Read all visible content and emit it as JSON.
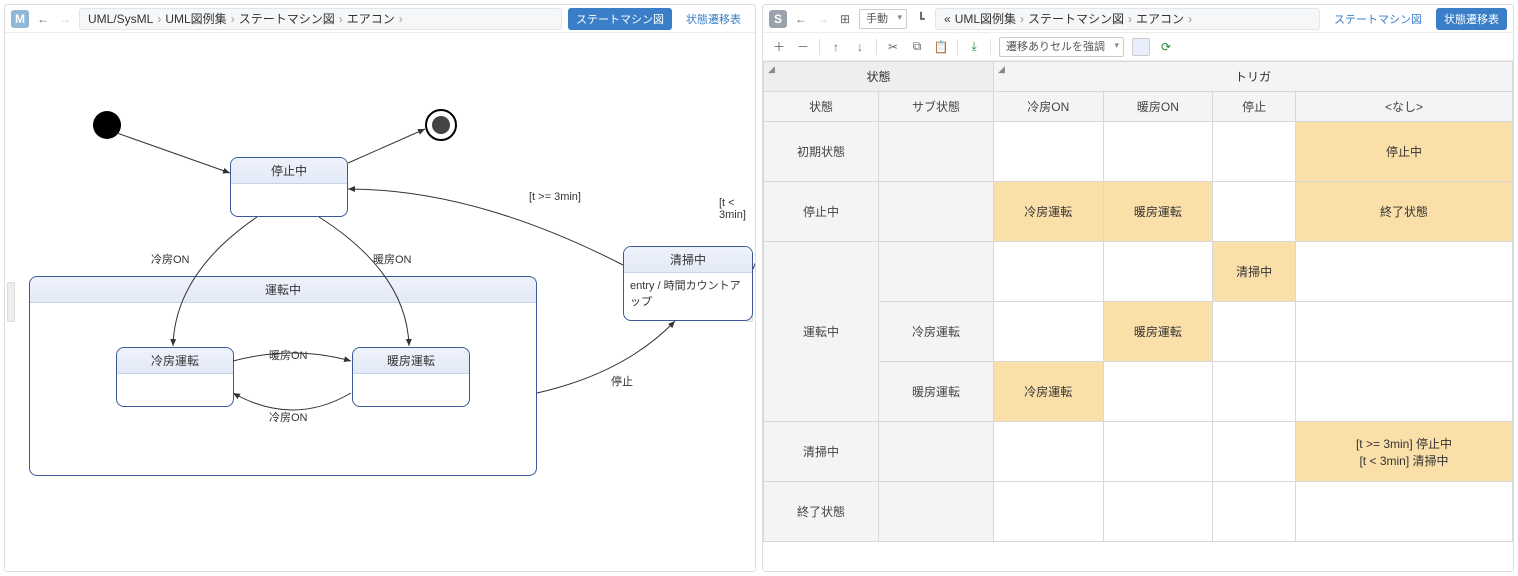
{
  "left": {
    "badge": "M",
    "crumbs": [
      "UML/SysML",
      "UML図例集",
      "ステートマシン図",
      "エアコン"
    ],
    "tab_active": "ステートマシン図",
    "tab_inactive": "状態遷移表"
  },
  "right": {
    "badge": "S",
    "crumbs_prefix": "«",
    "crumbs": [
      "UML図例集",
      "ステートマシン図",
      "エアコン"
    ],
    "tab_inactive": "ステートマシン図",
    "tab_active": "状態遷移表",
    "layout_label": "手動",
    "dropdown": "遷移ありセルを強調"
  },
  "states": {
    "stopped": "停止中",
    "running": "運転中",
    "cool": "冷房運転",
    "heat": "暖房運転",
    "clean": "清掃中",
    "clean_entry": "entry / 時間カウントアップ"
  },
  "edges": {
    "cool_on": "冷房ON",
    "heat_on": "暖房ON",
    "stop": "停止",
    "g_ge": "[t >= 3min]",
    "g_lt": "[t < 3min]"
  },
  "table": {
    "h_state": "状態",
    "h_trigger": "トリガ",
    "h_sub": "サブ状態",
    "cols": [
      "冷房ON",
      "暖房ON",
      "停止",
      "<なし>"
    ],
    "rows": [
      {
        "state": "初期状態",
        "sub": "",
        "cells": [
          "",
          "",
          "",
          {
            "t": "停止中",
            "hl": true
          }
        ]
      },
      {
        "state": "停止中",
        "sub": "",
        "cells": [
          {
            "t": "冷房運転",
            "hl": true
          },
          {
            "t": "暖房運転",
            "hl": true
          },
          "",
          {
            "t": "終了状態",
            "hl": true
          }
        ]
      },
      {
        "state": "",
        "sub": "",
        "cells": [
          "",
          "",
          {
            "t": "清掃中",
            "hl": true
          },
          ""
        ]
      },
      {
        "state": "運転中",
        "sub": "冷房運転",
        "cells": [
          "",
          {
            "t": "暖房運転",
            "hl": true
          },
          "",
          ""
        ]
      },
      {
        "state": "",
        "sub": "暖房運転",
        "cells": [
          {
            "t": "冷房運転",
            "hl": true
          },
          "",
          "",
          ""
        ]
      },
      {
        "state": "清掃中",
        "sub": "",
        "cells": [
          "",
          "",
          "",
          {
            "t": "[t >= 3min] 停止中\n[t < 3min] 清掃中",
            "hl": true
          }
        ]
      },
      {
        "state": "終了状態",
        "sub": "",
        "cells": [
          "",
          "",
          "",
          ""
        ]
      }
    ]
  }
}
